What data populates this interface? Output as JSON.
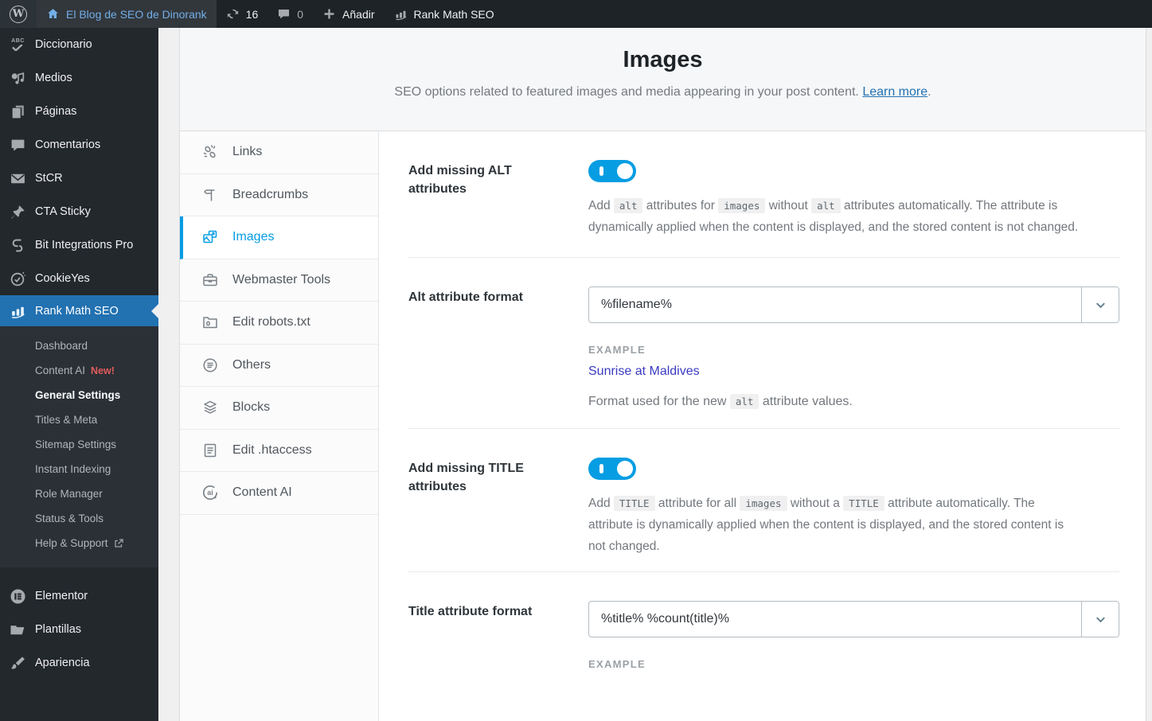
{
  "colors": {
    "accent": "#069de3",
    "selected_menu_blue": "#2271b1",
    "badge_red": "#e35b5b",
    "link_blue": "#2271b1",
    "example_blue": "#3a3ac1",
    "admin_bar_bg": "#1d2327",
    "sidebar_bg": "#23282d"
  },
  "admin_bar": {
    "site_name": "El Blog de SEO de Dinorank",
    "updates_count": "16",
    "comments_count": "0",
    "add_new_label": "Añadir",
    "rank_math_label": "Rank Math SEO"
  },
  "sidebar": {
    "items": [
      {
        "label": "Diccionario",
        "icon": "abc-check-icon"
      },
      {
        "label": "Medios",
        "icon": "media-icon"
      },
      {
        "label": "Páginas",
        "icon": "pages-icon"
      },
      {
        "label": "Comentarios",
        "icon": "comment-icon"
      },
      {
        "label": "StCR",
        "icon": "envelope-icon"
      },
      {
        "label": "CTA Sticky",
        "icon": "pushpin-icon"
      },
      {
        "label": "Bit Integrations Pro",
        "icon": "bit-integrations-icon"
      },
      {
        "label": "CookieYes",
        "icon": "cookie-check-icon"
      }
    ],
    "rank_math": {
      "label": "Rank Math SEO",
      "icon": "rank-math-chart-icon"
    },
    "submenu": [
      {
        "label": "Dashboard"
      },
      {
        "label": "Content AI",
        "badge": "New!"
      },
      {
        "label": "General Settings",
        "active": true
      },
      {
        "label": "Titles & Meta"
      },
      {
        "label": "Sitemap Settings"
      },
      {
        "label": "Instant Indexing"
      },
      {
        "label": "Role Manager"
      },
      {
        "label": "Status & Tools"
      },
      {
        "label": "Help & Support",
        "external": true
      }
    ],
    "bottom_items": [
      {
        "label": "Elementor",
        "icon": "elementor-icon"
      },
      {
        "label": "Plantillas",
        "icon": "folder-icon"
      },
      {
        "label": "Apariencia",
        "icon": "brush-icon"
      }
    ]
  },
  "header": {
    "title": "Images",
    "subtitle_parts": [
      {
        "t": "text",
        "v": "SEO options related to featured images and media appearing in your post content. "
      },
      {
        "t": "link",
        "v": "Learn more"
      },
      {
        "t": "text",
        "v": "."
      }
    ]
  },
  "tabs": [
    {
      "label": "Links",
      "icon": "broken-link-icon"
    },
    {
      "label": "Breadcrumbs",
      "icon": "signpost-icon"
    },
    {
      "label": "Images",
      "icon": "images-icon",
      "active": true
    },
    {
      "label": "Webmaster Tools",
      "icon": "briefcase-icon"
    },
    {
      "label": "Edit robots.txt",
      "icon": "folder-file-icon"
    },
    {
      "label": "Others",
      "icon": "list-circle-icon"
    },
    {
      "label": "Blocks",
      "icon": "layers-icon"
    },
    {
      "label": "Edit .htaccess",
      "icon": "document-icon"
    },
    {
      "label": "Content AI",
      "icon": "content-ai-icon"
    }
  ],
  "settings": {
    "alt_toggle": {
      "label": "Add missing ALT attributes",
      "state": "on",
      "description": [
        {
          "t": "text",
          "v": "Add "
        },
        {
          "t": "code",
          "v": "alt"
        },
        {
          "t": "text",
          "v": " attributes for "
        },
        {
          "t": "code",
          "v": "images"
        },
        {
          "t": "text",
          "v": " without "
        },
        {
          "t": "code",
          "v": "alt"
        },
        {
          "t": "text",
          "v": " attributes automatically. The attribute is dynamically applied when the content is displayed, and the stored content is not changed."
        }
      ]
    },
    "alt_format": {
      "label": "Alt attribute format",
      "value": "%filename%",
      "example_label": "EXAMPLE",
      "example_value": "Sunrise at Maldives",
      "help": [
        {
          "t": "text",
          "v": "Format used for the new "
        },
        {
          "t": "code",
          "v": "alt"
        },
        {
          "t": "text",
          "v": " attribute values."
        }
      ]
    },
    "title_toggle": {
      "label": "Add missing TITLE attributes",
      "state": "on",
      "description": [
        {
          "t": "text",
          "v": "Add "
        },
        {
          "t": "code",
          "v": "TITLE"
        },
        {
          "t": "text",
          "v": " attribute for all "
        },
        {
          "t": "code",
          "v": "images"
        },
        {
          "t": "text",
          "v": " without a "
        },
        {
          "t": "code",
          "v": "TITLE"
        },
        {
          "t": "text",
          "v": " attribute automatically. The attribute is dynamically applied when the content is displayed, and the stored content is not changed."
        }
      ]
    },
    "title_format": {
      "label": "Title attribute format",
      "value": "%title% %count(title)%",
      "example_label": "EXAMPLE"
    }
  }
}
